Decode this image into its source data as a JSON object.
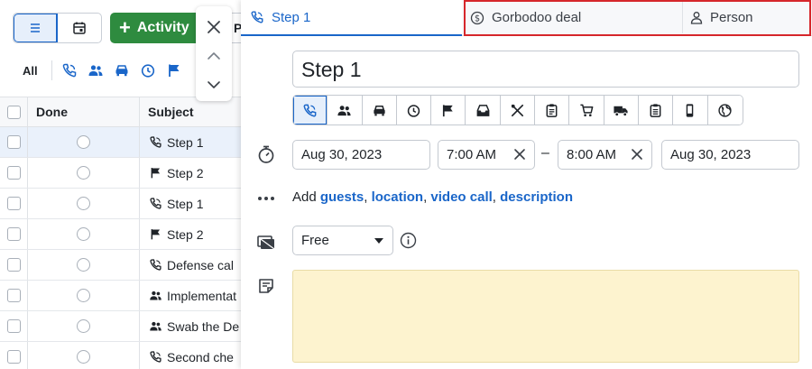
{
  "colors": {
    "accent": "#1a66c9",
    "green": "#2e8b3f",
    "highlight": "#d6262b",
    "note_bg": "#fdf3cf"
  },
  "toolbar": {
    "add_activity_label": "Activity",
    "partial_label": "Pr"
  },
  "filters": {
    "all_label": "All",
    "icons": [
      "phone-icon",
      "meeting-icon",
      "car-icon",
      "clock-icon",
      "flag-icon"
    ]
  },
  "grid": {
    "headers": {
      "done": "Done",
      "subject": "Subject"
    },
    "rows": [
      {
        "icon": "phone",
        "subject": "Step 1",
        "selected": true
      },
      {
        "icon": "flag",
        "subject": "Step 2"
      },
      {
        "icon": "phone",
        "subject": "Step 1"
      },
      {
        "icon": "flag",
        "subject": "Step 2"
      },
      {
        "icon": "phone",
        "subject": "Defense cal"
      },
      {
        "icon": "meeting",
        "subject": "Implementat"
      },
      {
        "icon": "meeting",
        "subject": "Swab the De"
      },
      {
        "icon": "phone",
        "subject": "Second che"
      }
    ]
  },
  "panel": {
    "tabs": {
      "activity": "Step 1",
      "deal": "Gorbodoo deal",
      "person": "Person"
    },
    "subject_value": "Step 1",
    "start_date": "Aug 30, 2023",
    "start_time": "7:00 AM",
    "dash": "–",
    "end_time": "8:00 AM",
    "end_date": "Aug 30, 2023",
    "add_prefix": "Add ",
    "add_links": {
      "guests": "guests",
      "location": "location",
      "video_call": "video call",
      "description": "description"
    },
    "add_sep": ", ",
    "busy_value": "Free"
  }
}
